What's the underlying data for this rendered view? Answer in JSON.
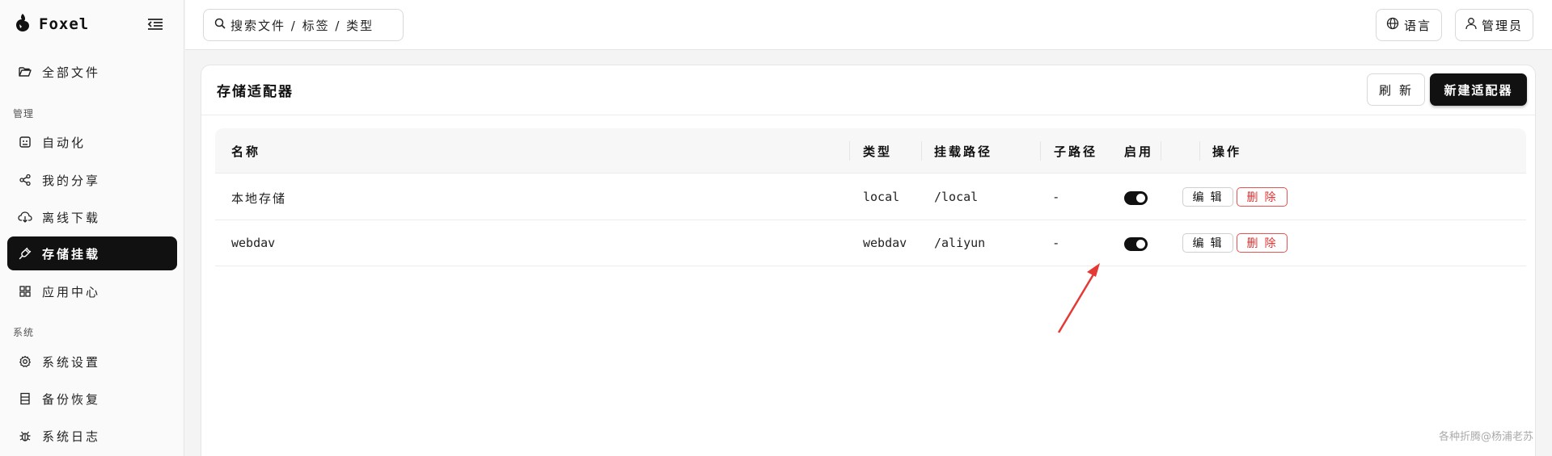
{
  "app": {
    "name": "Foxel"
  },
  "sidebar": {
    "top_item": {
      "label": "全部文件",
      "icon": "folder-open-icon"
    },
    "section_manage": "管理",
    "manage_items": [
      {
        "label": "自动化",
        "icon": "robot-icon"
      },
      {
        "label": "我的分享",
        "icon": "share-icon"
      },
      {
        "label": "离线下载",
        "icon": "cloud-download-icon"
      },
      {
        "label": "存储挂载",
        "icon": "plug-icon",
        "active": true
      },
      {
        "label": "应用中心",
        "icon": "apps-grid-icon"
      }
    ],
    "section_system": "系统",
    "system_items": [
      {
        "label": "系统设置",
        "icon": "gear-icon"
      },
      {
        "label": "备份恢复",
        "icon": "archive-icon"
      },
      {
        "label": "系统日志",
        "icon": "bug-icon"
      }
    ]
  },
  "topbar": {
    "search_label": "搜索文件 / 标签 / 类型",
    "language_label": "语言",
    "user_label": "管理员"
  },
  "page": {
    "title": "存储适配器",
    "refresh_label": "刷新",
    "new_label": "新建适配器"
  },
  "table": {
    "columns": [
      "名称",
      "类型",
      "挂载路径",
      "子路径",
      "启用",
      "操作"
    ],
    "rows": [
      {
        "name": "本地存储",
        "type": "local",
        "mount_path": "/local",
        "sub_path": "-",
        "enabled": true
      },
      {
        "name": "webdav",
        "type": "webdav",
        "mount_path": "/aliyun",
        "sub_path": "-",
        "enabled": true
      }
    ],
    "edit_label": "编辑",
    "delete_label": "删除"
  },
  "watermark": "各种折腾@杨浦老苏",
  "colors": {
    "accent": "#111111",
    "danger": "#e03131",
    "annotation": "#e53935"
  }
}
